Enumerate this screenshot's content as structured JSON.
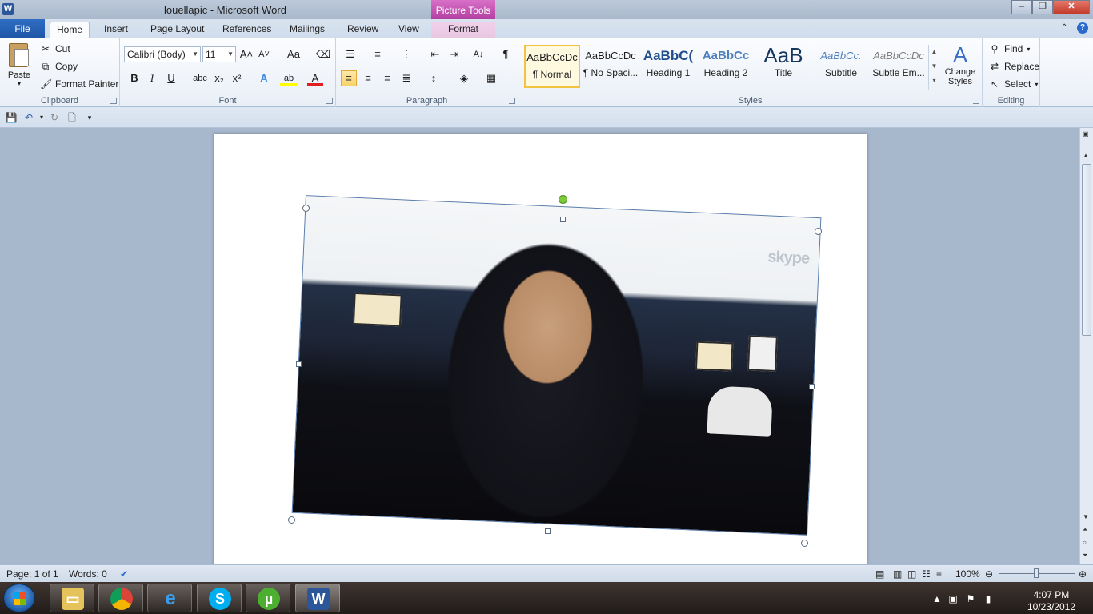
{
  "window": {
    "app_letter": "W",
    "title": "louellapic  -  Microsoft Word",
    "context_tab": "Picture Tools",
    "controls": {
      "minimize": "–",
      "maximize": "❐",
      "close": "✕"
    }
  },
  "tabs": {
    "file": "File",
    "home": "Home",
    "insert": "Insert",
    "page_layout": "Page Layout",
    "references": "References",
    "mailings": "Mailings",
    "review": "Review",
    "view": "View",
    "format": "Format"
  },
  "ribbon": {
    "clipboard": {
      "label": "Clipboard",
      "paste": "Paste",
      "cut": "Cut",
      "copy": "Copy",
      "format_painter": "Format Painter"
    },
    "font": {
      "label": "Font",
      "font_name": "Calibri (Body)",
      "font_size": "11",
      "bold": "B",
      "italic": "I",
      "underline": "U",
      "strike": "abc",
      "subscript": "x₂",
      "superscript": "x²",
      "grow": "A˄",
      "shrink": "A˅",
      "change_case": "Aa",
      "text_effects": "A",
      "highlight": "ab",
      "font_color": "A"
    },
    "paragraph": {
      "label": "Paragraph",
      "show_marks": "¶",
      "sort": "A↓"
    },
    "styles": {
      "label": "Styles",
      "items": [
        {
          "sample": "AaBbCcDc",
          "name": "¶ Normal"
        },
        {
          "sample": "AaBbCcDc",
          "name": "¶ No Spaci..."
        },
        {
          "sample": "AaBbC(",
          "name": "Heading 1"
        },
        {
          "sample": "AaBbCc",
          "name": "Heading 2"
        },
        {
          "sample": "AaB",
          "name": "Title"
        },
        {
          "sample": "AaBbCc.",
          "name": "Subtitle"
        },
        {
          "sample": "AaBbCcDc",
          "name": "Subtle Em..."
        }
      ],
      "change_styles_line1": "Change",
      "change_styles_line2": "Styles"
    },
    "editing": {
      "label": "Editing",
      "find": "Find",
      "replace": "Replace",
      "select": "Select"
    }
  },
  "document": {
    "watermark": "skype"
  },
  "status": {
    "page": "Page: 1 of 1",
    "words": "Words: 0",
    "zoom": "100%"
  },
  "taskbar": {
    "time": "4:07 PM",
    "date": "10/23/2012"
  },
  "colors": {
    "file_tab": "#2b64b8",
    "context_tab": "#c44db2",
    "selected_style_border": "#f2c340"
  }
}
